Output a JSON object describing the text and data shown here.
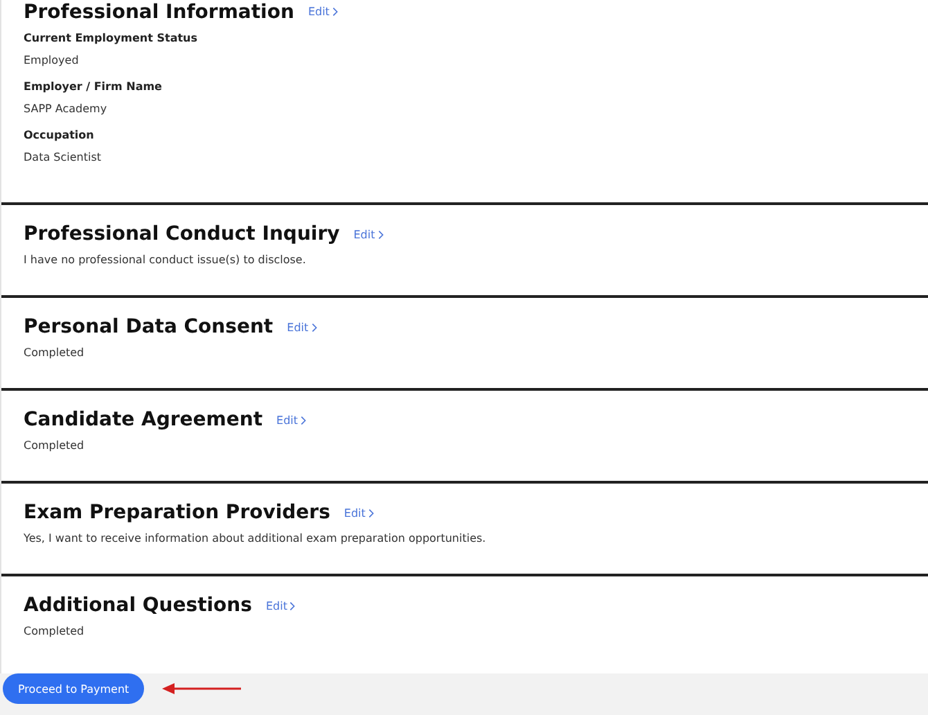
{
  "sections": [
    {
      "kind": "fields",
      "title": "Professional Information",
      "edit": "Edit",
      "fields": [
        {
          "label": "Current Employment Status",
          "value": "Employed"
        },
        {
          "label": "Employer / Firm Name",
          "value": "SAPP Academy"
        },
        {
          "label": "Occupation",
          "value": "Data Scientist"
        }
      ]
    },
    {
      "kind": "text",
      "title": "Professional Conduct Inquiry",
      "edit": "Edit",
      "text": "I have no professional conduct issue(s) to disclose."
    },
    {
      "kind": "text",
      "title": "Personal Data Consent",
      "edit": "Edit",
      "text": "Completed"
    },
    {
      "kind": "text",
      "title": "Candidate Agreement",
      "edit": "Edit",
      "text": "Completed"
    },
    {
      "kind": "text",
      "title": "Exam Preparation Providers",
      "edit": "Edit",
      "text": "Yes, I want to receive information about additional exam preparation opportunities."
    },
    {
      "kind": "text",
      "title": "Additional Questions",
      "edit": "Edit",
      "text": "Completed"
    }
  ],
  "footer": {
    "button": "Proceed to Payment"
  }
}
